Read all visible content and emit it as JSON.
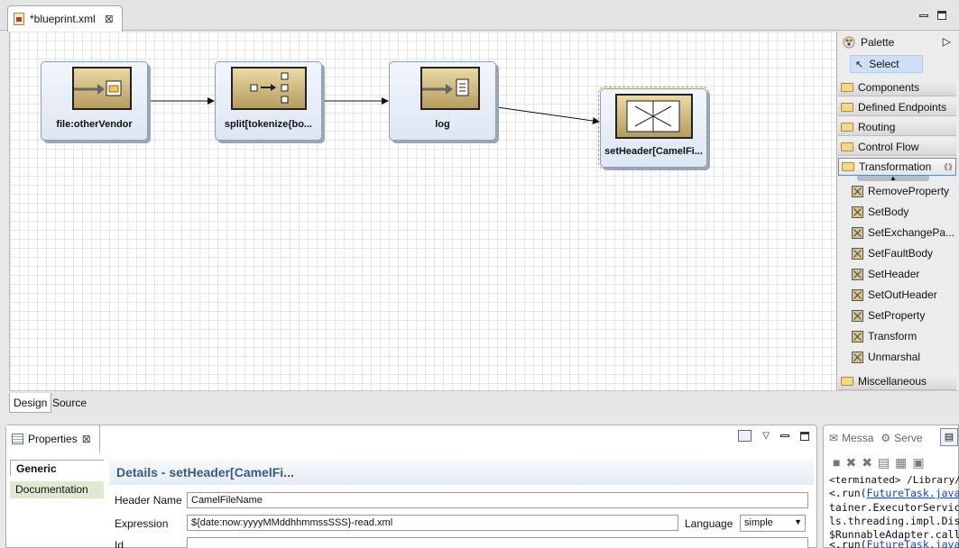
{
  "editor": {
    "tab_title": "*blueprint.xml",
    "close_glyph": "⊠"
  },
  "diagram": {
    "nodes": [
      {
        "label": "file:otherVendor"
      },
      {
        "label": "split[tokenize{bo..."
      },
      {
        "label": "log"
      },
      {
        "label": "setHeader[CamelFi..."
      }
    ]
  },
  "palette": {
    "title": "Palette",
    "select_label": "Select",
    "drawers": [
      "Components",
      "Defined Endpoints",
      "Routing",
      "Control Flow",
      "Transformation",
      "Miscellaneous"
    ],
    "transformation_items": [
      "RemoveProperty",
      "SetBody",
      "SetExchangePa...",
      "SetFaultBody",
      "SetHeader",
      "SetOutHeader",
      "SetProperty",
      "Transform",
      "Unmarshal"
    ]
  },
  "editor_tabs": {
    "design": "Design",
    "source": "Source"
  },
  "properties": {
    "view_title": "Properties",
    "tabs": [
      "Generic",
      "Documentation"
    ],
    "details_title": "Details - setHeader[CamelFi...",
    "header_name_label": "Header Name",
    "header_name_value": "CamelFileName",
    "expression_label": "Expression",
    "expression_value": "${date:now:yyyyMMddhhmmssSSS}-read.xml",
    "language_label": "Language",
    "language_value": "simple",
    "id_label": "Id",
    "id_value": ""
  },
  "console": {
    "tabs": [
      "Messa",
      "Serve"
    ],
    "lines": [
      {
        "text": "<terminated> /Library/Java",
        "link": ""
      },
      {
        "pre": "<.run(",
        "link": "FutureTask.java"
      },
      {
        "text": "tainer.ExecutorServic",
        "link": ""
      },
      {
        "text": "ls.threading.impl.Dis",
        "link": ""
      },
      {
        "text": "$RunnableAdapter.call",
        "link": ""
      },
      {
        "pre": "<.run(",
        "link": "FutureTask.java"
      }
    ]
  },
  "colors": {
    "accent_link": "#1a3fc4",
    "details_header": "#3b5b80",
    "selected_tab": "#dfe8d0"
  }
}
